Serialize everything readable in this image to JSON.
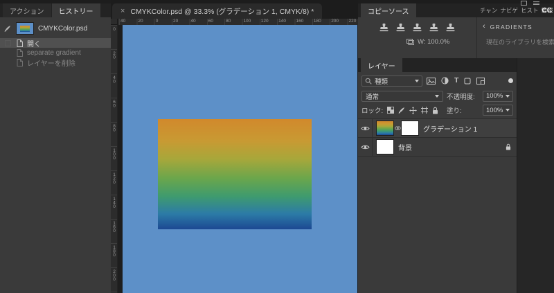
{
  "window": {
    "doc_tab": {
      "close": "×",
      "title": "CMYKColor.psd @ 33.3% (グラデーション 1, CMYK/8) *"
    }
  },
  "history_panel": {
    "tabs": {
      "actions": "アクション",
      "history": "ヒストリー"
    },
    "items": [
      {
        "label": "CMYKColor.psd"
      },
      {
        "label": "開く"
      },
      {
        "label": "separate gradient"
      },
      {
        "label": "レイヤーを削除"
      }
    ]
  },
  "clone_source_panel": {
    "tab": "コピーソース",
    "w_value": "W: 100.0%"
  },
  "right_dock": {
    "tabs": [
      "チャン",
      "ナビゲ",
      "ヒスト",
      "情報"
    ],
    "cc_badge": "CC",
    "gradients": {
      "back_chevron": "‹",
      "title": "GRADIENTS",
      "search_placeholder": "現在のライブラリを検索"
    }
  },
  "layers_panel": {
    "tab": "レイヤー",
    "kind_filter_label": "種類",
    "type_icon_letter": "T",
    "blend_mode": "通常",
    "opacity_label": "不透明度:",
    "opacity_value": "100%",
    "lock_label": "ロック:",
    "fill_label": "塗り:",
    "fill_value": "100%",
    "layers": [
      {
        "name": "グラデーション 1"
      },
      {
        "name": "背景"
      }
    ]
  },
  "canvas": {
    "ruler_top": [
      "40",
      "20",
      "0",
      "20",
      "40",
      "60",
      "80",
      "100",
      "120",
      "140",
      "160",
      "180",
      "200",
      "220"
    ],
    "ruler_left": [
      "0",
      "20",
      "40",
      "60",
      "80",
      "100",
      "120",
      "140",
      "160",
      "180",
      "200"
    ],
    "colors": {
      "document_blue": "#5d90c8",
      "gradient_stops": [
        "#d1892c 0%",
        "#c89a33 20%",
        "#a8a73a 36%",
        "#6aa64c 54%",
        "#3f9b6e 70%",
        "#2c7ba7 86%",
        "#1c4892 100%"
      ]
    }
  }
}
